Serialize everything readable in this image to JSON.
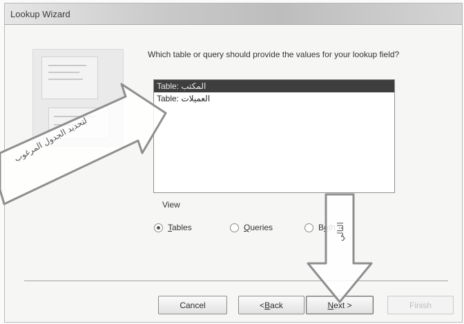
{
  "window": {
    "title": "Lookup Wizard"
  },
  "prompt": {
    "question": "Which table or query should provide the values for your lookup field?"
  },
  "list": {
    "items": [
      {
        "label": "Table: المكتب",
        "selected": true
      },
      {
        "label": "Table: العميلات",
        "selected": false
      }
    ]
  },
  "view": {
    "label": "View",
    "options": [
      {
        "prefix": "",
        "mnemonic": "T",
        "rest": "ables",
        "checked": true
      },
      {
        "prefix": "",
        "mnemonic": "Q",
        "rest": "ueries",
        "checked": false
      },
      {
        "prefix": "B",
        "mnemonic": "o",
        "rest": "th",
        "checked": false
      }
    ]
  },
  "buttons": {
    "cancel": {
      "label": "Cancel"
    },
    "back": {
      "prefix": "< ",
      "mnemonic": "B",
      "rest": "ack"
    },
    "next": {
      "mnemonic": "N",
      "rest": "ext >"
    },
    "finish": {
      "label": "Finish"
    }
  },
  "annotations": {
    "left_arrow_text": "لتحديد الجدول المرغوب",
    "down_arrow_text": "التالي"
  },
  "colors": {
    "selection_bg": "#3e3e3e",
    "window_bg": "#f6f6f5",
    "annotation_arrow": "#9a9a9a"
  }
}
